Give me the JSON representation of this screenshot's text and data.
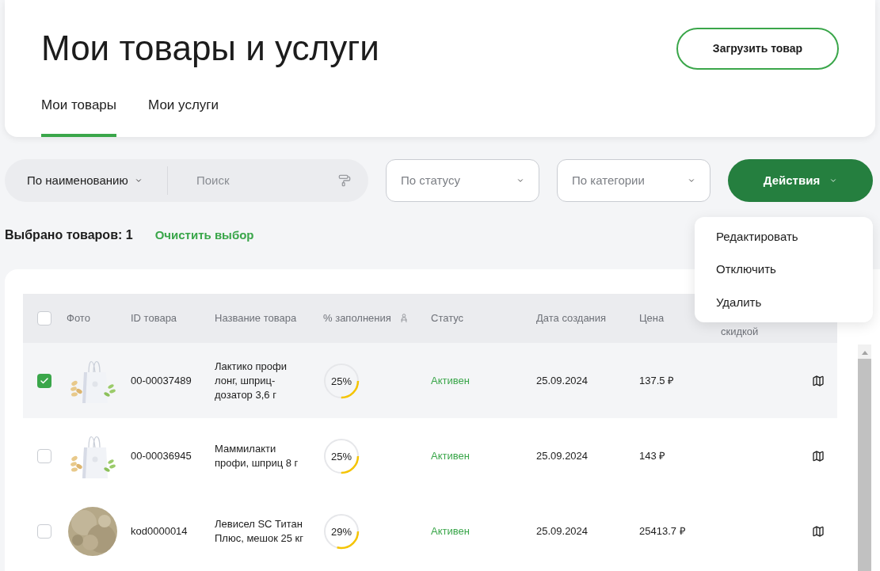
{
  "header": {
    "title": "Мои товары и услуги",
    "upload_button": "Загрузить товар",
    "tabs": [
      {
        "label": "Мои товары",
        "selected": true
      },
      {
        "label": "Мои услуги",
        "selected": false
      }
    ]
  },
  "filters": {
    "search_mode": "По наименованию",
    "search_placeholder": "Поиск",
    "status_placeholder": "По статусу",
    "category_placeholder": "По категории",
    "actions_button": "Действия"
  },
  "actions_menu": {
    "items": [
      "Редактировать",
      "Отключить",
      "Удалить"
    ]
  },
  "selection": {
    "count_label": "Выбрано товаров: 1",
    "clear_link": "Очистить выбор"
  },
  "table": {
    "select_all_checked": false,
    "columns": [
      "Фото",
      "ID товара",
      "Название товара",
      "% заполнения",
      "Статус",
      "Дата создания",
      "Цена",
      "скидкой"
    ],
    "rows": [
      {
        "checked": true,
        "id": "00-00037489",
        "name": "Лактико профи лонг, шприц-дозатор 3,6 г",
        "fill": "25%",
        "level": 0.25,
        "status": "Активен",
        "date": "25.09.2024",
        "price": "137.5 ₽"
      },
      {
        "checked": false,
        "id": "00-00036945",
        "name": "Маммилакти профи, шприц 8 г",
        "fill": "25%",
        "level": 0.25,
        "status": "Активен",
        "date": "25.09.2024",
        "price": "143 ₽"
      },
      {
        "checked": false,
        "id": "kod0000014",
        "name": "Левисел SC Титан Плюс, мешок 25 кг",
        "fill": "29%",
        "level": 0.29,
        "status": "Активен",
        "date": "25.09.2024",
        "price": "25413.7 ₽"
      }
    ]
  }
}
